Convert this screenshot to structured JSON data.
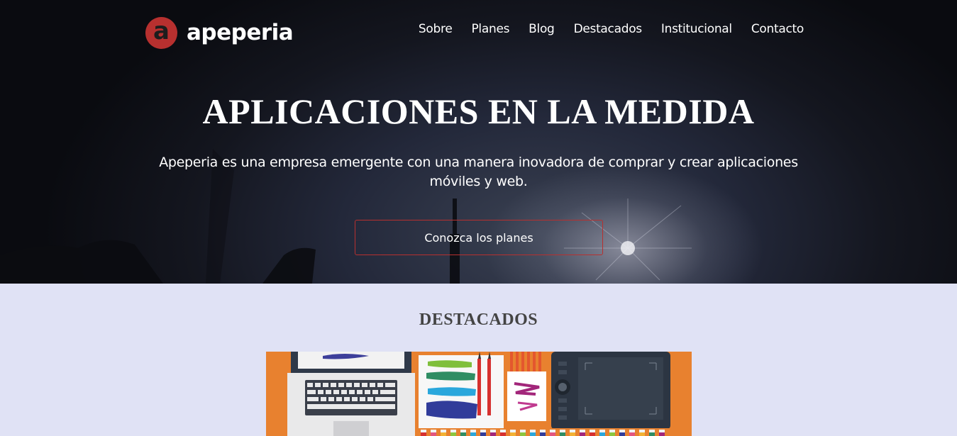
{
  "brand": {
    "name": "apeperia",
    "mark": "a",
    "accent": "#b7302f"
  },
  "nav": {
    "items": [
      "Sobre",
      "Planes",
      "Blog",
      "Destacados",
      "Institucional",
      "Contacto"
    ]
  },
  "hero": {
    "title": "APLICACIONES EN LA MEDIDA",
    "subtitle": "Apeperia es una empresa emergente con una manera inovadora de comprar y crear aplicaciones móviles y web.",
    "cta": "Conozca los planes"
  },
  "featured": {
    "title": "DESTACADOS",
    "image": "design-tools-illustration",
    "background": "#e8812f"
  }
}
